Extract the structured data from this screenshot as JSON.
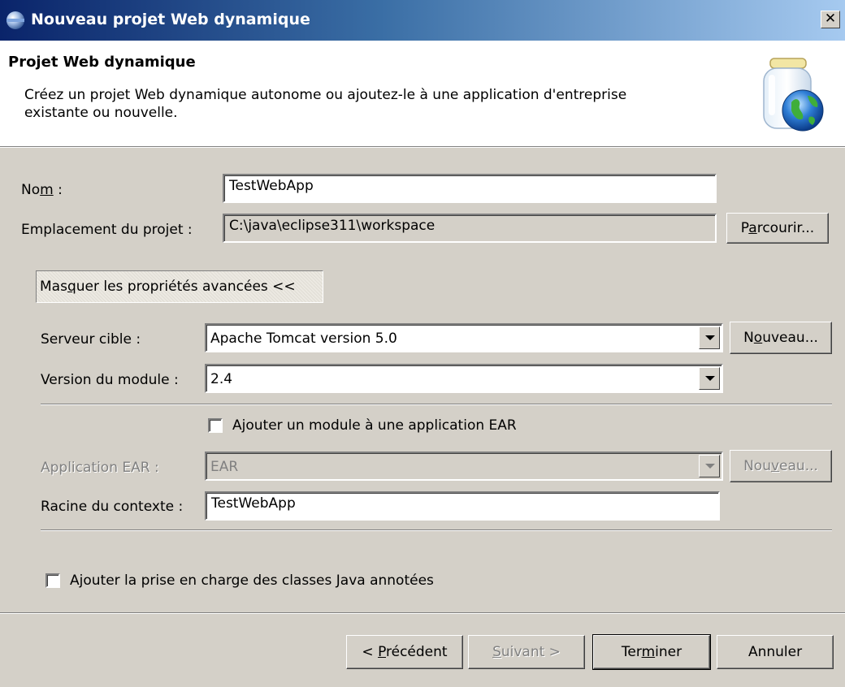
{
  "window": {
    "title": "Nouveau projet Web dynamique",
    "close_glyph": "✕"
  },
  "header": {
    "title": "Projet Web dynamique",
    "description": "Créez un projet Web dynamique autonome ou ajoutez-le à une application d'entreprise existante ou nouvelle.",
    "illustration": "globe-jar-icon"
  },
  "form": {
    "name_label_pre": "No",
    "name_label_mn": "m",
    "name_label_post": " :",
    "name_value": "TestWebApp",
    "location_label": "Emplacement du projet :",
    "location_value": "C:\\java\\eclipse311\\workspace",
    "browse_pre": "P",
    "browse_mn": "a",
    "browse_post": "rcourir..."
  },
  "advanced": {
    "toggle_pre": "Mas",
    "toggle_mn": "q",
    "toggle_post": "uer les propriétés avancées <<",
    "target_server_label": "Serveur cible :",
    "target_server_value": "Apache Tomcat version 5.0",
    "new_server_pre": "N",
    "new_server_mn": "o",
    "new_server_post": "uveau...",
    "module_version_label": "Version du module :",
    "module_version_value": "2.4",
    "add_ear_label": "Ajouter un module à une application EAR",
    "add_ear_checked": false,
    "ear_app_label": "Application EAR :",
    "ear_app_value": "EAR",
    "new_ear_pre": "Nou",
    "new_ear_mn": "v",
    "new_ear_post": "eau...",
    "context_root_label": "Racine du contexte :",
    "context_root_value": "TestWebApp",
    "annotations_label": "Ajouter la prise en charge des classes Java annotées",
    "annotations_checked": false
  },
  "buttons": {
    "back_pre": "< ",
    "back_mn": "P",
    "back_post": "récédent",
    "next_mn": "S",
    "next_post": "uivant >",
    "finish_pre": "Ter",
    "finish_mn": "m",
    "finish_post": "iner",
    "cancel": "Annuler"
  }
}
